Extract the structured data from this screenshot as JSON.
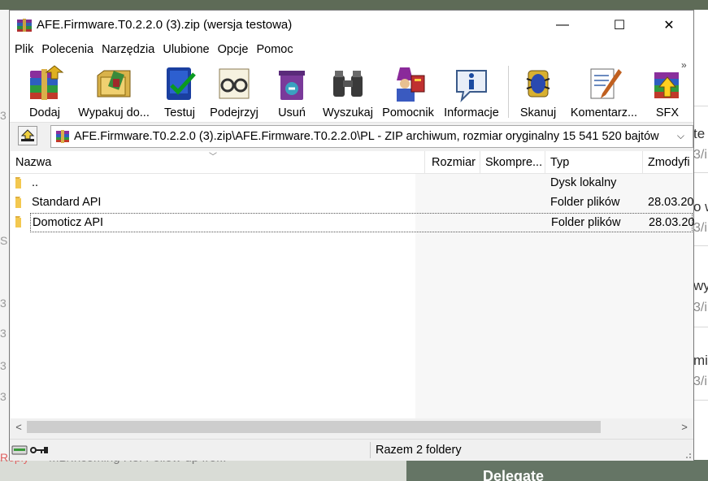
{
  "window": {
    "title": "AFE.Firmware.T0.2.2.0 (3).zip (wersja testowa)",
    "minimize": "—",
    "maximize": "☐",
    "close": "✕"
  },
  "menu": [
    "Plik",
    "Polecenia",
    "Narzędzia",
    "Ulubione",
    "Opcje",
    "Pomoc"
  ],
  "toolbar": {
    "buttons": [
      {
        "label": "Dodaj",
        "icon": "add-archive-icon"
      },
      {
        "label": "Wypakuj do...",
        "icon": "extract-icon"
      },
      {
        "label": "Testuj",
        "icon": "test-icon"
      },
      {
        "label": "Podejrzyj",
        "icon": "view-icon"
      },
      {
        "label": "Usuń",
        "icon": "delete-icon"
      },
      {
        "label": "Wyszukaj",
        "icon": "find-icon"
      },
      {
        "label": "Pomocnik",
        "icon": "wizard-icon"
      },
      {
        "label": "Informacje",
        "icon": "info-icon"
      },
      {
        "label": "Skanuj",
        "icon": "scan-icon"
      },
      {
        "label": "Komentarz...",
        "icon": "comment-icon"
      },
      {
        "label": "SFX",
        "icon": "sfx-icon"
      }
    ],
    "more": "»"
  },
  "address": {
    "path": "AFE.Firmware.T0.2.2.0 (3).zip\\AFE.Firmware.T0.2.2.0\\PL - ZIP archiwum, rozmiar oryginalny 15 541 520 bajtów",
    "dropdown": "⌵"
  },
  "columns": [
    "Nazwa",
    "Rozmiar",
    "Skompre...",
    "Typ",
    "Zmodyfi"
  ],
  "files": [
    {
      "name": "..",
      "size": "",
      "packed": "",
      "type": "Dysk lokalny",
      "modified": ""
    },
    {
      "name": "Standard API",
      "size": "",
      "packed": "",
      "type": "Folder plików",
      "modified": "28.03.20"
    },
    {
      "name": "Domoticz API",
      "size": "",
      "packed": "",
      "type": "Folder plików",
      "modified": "28.03.20"
    }
  ],
  "scrollbar": {
    "left": "<",
    "right": ">"
  },
  "status": {
    "text": "Razem 2 foldery"
  },
  "background": {
    "right_fragments": [
      "te",
      "3/i",
      "o w",
      "3/i",
      "wy",
      "3/i",
      "mi",
      "3/i"
    ],
    "left_fragments": [
      "3",
      "S",
      "3",
      "3",
      "3",
      "3",
      "3",
      "3"
    ],
    "bottom_reply": "Reply",
    "bottom_text": "MB/Incoming  Re: Follow-up fro...",
    "bottom_delegate": "Delegate"
  }
}
